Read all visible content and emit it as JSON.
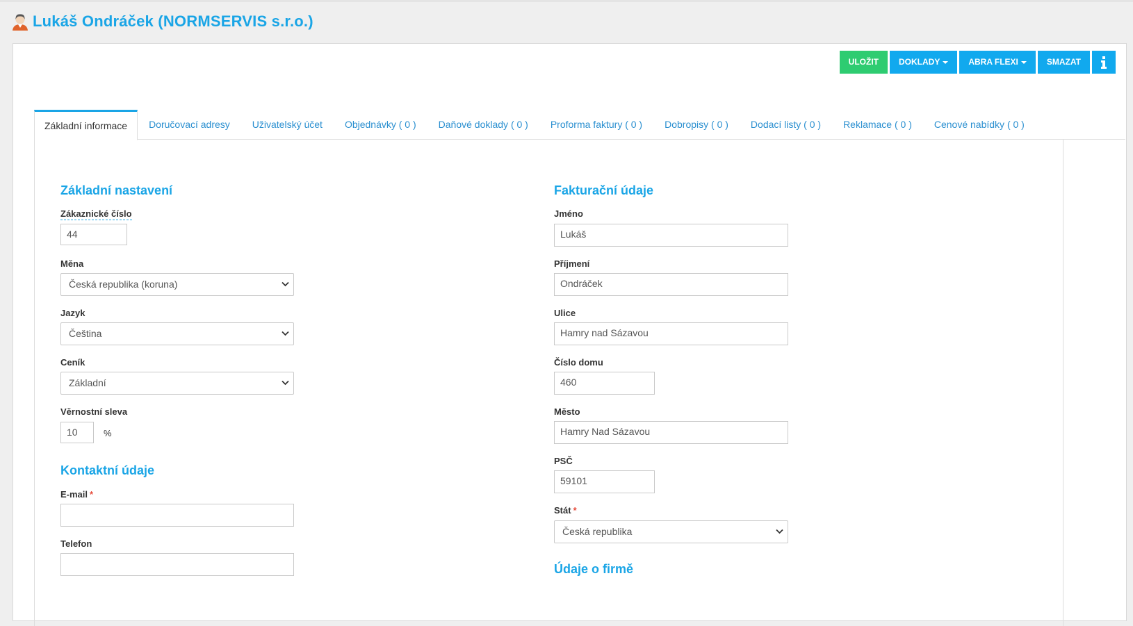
{
  "header": {
    "title": "Lukáš Ondráček (NORMSERVIS s.r.o.)",
    "icon": "user-avatar-icon"
  },
  "toolbar": {
    "save": "ULOŽIT",
    "documents": "DOKLADY",
    "abra": "ABRA FLEXI",
    "delete": "SMAZAT",
    "info": "i"
  },
  "tabs": [
    {
      "label": "Základní informace"
    },
    {
      "label": "Doručovací adresy"
    },
    {
      "label": "Uživatelský účet"
    },
    {
      "label": "Objednávky ( 0 )"
    },
    {
      "label": "Daňové doklady ( 0 )"
    },
    {
      "label": "Proforma faktury ( 0 )"
    },
    {
      "label": "Dobropisy ( 0 )"
    },
    {
      "label": "Dodací listy ( 0 )"
    },
    {
      "label": "Reklamace ( 0 )"
    },
    {
      "label": "Cenové nabídky ( 0 )"
    }
  ],
  "basic": {
    "title": "Základní nastavení",
    "customer_no_label": "Zákaznické číslo",
    "customer_no": "44",
    "currency_label": "Měna",
    "currency": "Česká republika (koruna)",
    "language_label": "Jazyk",
    "language": "Čeština",
    "pricelist_label": "Ceník",
    "pricelist": "Základní",
    "loyalty_label": "Věrnostní sleva",
    "loyalty": "10",
    "loyalty_unit": "%"
  },
  "contact": {
    "title": "Kontaktní údaje",
    "email_label": "E-mail",
    "email": "",
    "phone_label": "Telefon",
    "phone": "",
    "required_mark": "*"
  },
  "billing": {
    "title": "Fakturační údaje",
    "first_name_label": "Jméno",
    "first_name": "Lukáš",
    "last_name_label": "Příjmení",
    "last_name": "Ondráček",
    "street_label": "Ulice",
    "street": "Hamry nad Sázavou",
    "house_no_label": "Číslo domu",
    "house_no": "460",
    "city_label": "Město",
    "city": "Hamry Nad Sázavou",
    "zip_label": "PSČ",
    "zip": "59101",
    "country_label": "Stát",
    "country": "Česká republika",
    "required_mark": "*"
  },
  "company": {
    "title": "Údaje o firmě"
  },
  "colors": {
    "accent": "#1aa5e6",
    "save": "#2ecc71",
    "button": "#11a9ee",
    "required": "#e74c3c"
  }
}
